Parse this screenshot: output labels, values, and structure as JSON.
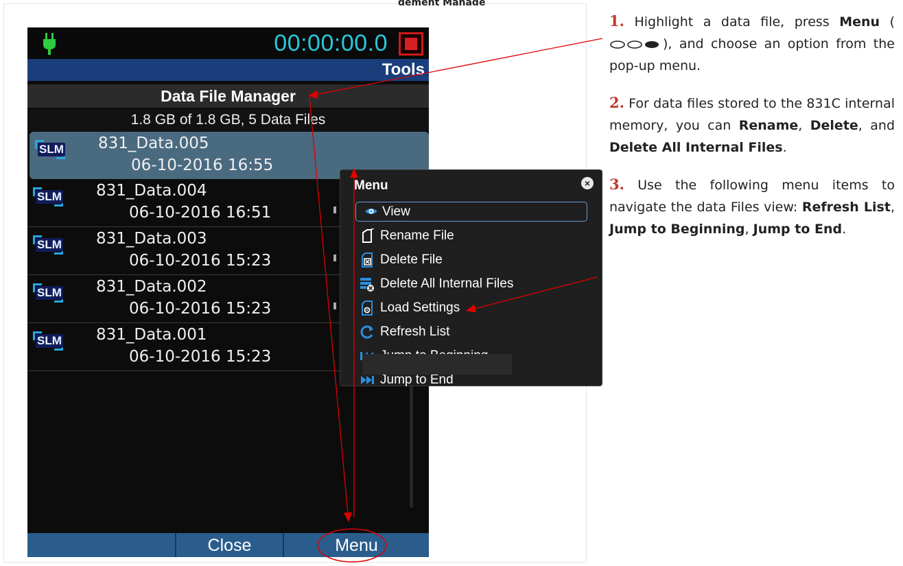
{
  "top_cut_text": "gement Manage",
  "device": {
    "clock": "00:00:00.0",
    "header_title": "Tools",
    "screen_title": "Data File Manager",
    "storage_summary": "1.8 GB of 1.8 GB, 5 Data Files",
    "files": [
      {
        "badge": "SLM",
        "name": "831_Data.005",
        "date": "06-10-2016 16:55",
        "selected": true
      },
      {
        "badge": "SLM",
        "name": "831_Data.004",
        "date": "06-10-2016 16:51",
        "selected": false
      },
      {
        "badge": "SLM",
        "name": "831_Data.003",
        "date": "06-10-2016 15:23",
        "selected": false
      },
      {
        "badge": "SLM",
        "name": "831_Data.002",
        "date": "06-10-2016 15:23",
        "selected": false
      },
      {
        "badge": "SLM",
        "name": "831_Data.001",
        "date": "06-10-2016 15:23",
        "selected": false
      }
    ],
    "bottom_buttons": [
      "",
      "Close",
      "Menu"
    ]
  },
  "popup": {
    "title": "Menu",
    "items": [
      {
        "label": "View",
        "icon": "eye-icon"
      },
      {
        "label": "Rename File",
        "icon": "rename-file-icon"
      },
      {
        "label": "Delete File",
        "icon": "delete-file-icon"
      },
      {
        "label": "Delete All Internal Files",
        "icon": "delete-all-icon"
      },
      {
        "label": "Load Settings",
        "icon": "load-settings-icon"
      },
      {
        "label": "Refresh List",
        "icon": "refresh-icon"
      },
      {
        "label": "Jump to Beginning",
        "icon": "jump-beginning-icon"
      },
      {
        "label": "Jump to End",
        "icon": "jump-end-icon"
      }
    ]
  },
  "notes": {
    "n1": {
      "num": "1.",
      "t1": " Highlight a data file, press ",
      "b1": "Menu",
      "t2": " (",
      "t3": "), and choose an option from the pop-up menu."
    },
    "n2": {
      "num": "2.",
      "t1": " For data files stored to the 831C internal memory, you can ",
      "b1": "Rename",
      "t2": ", ",
      "b2": "Delete",
      "t3": ", and ",
      "b3": "Delete All Internal Files",
      "t4": "."
    },
    "n3": {
      "num": "3.",
      "t1": " Use the following menu items to navigate the data Files view: ",
      "b1": "Refresh List",
      "t2": ", ",
      "b2": "Jump to Beginning",
      "t3": ", ",
      "b3": "Jump to End",
      "t4": "."
    }
  },
  "colors": {
    "annotation": "#e00000",
    "clock": "#28c8dc",
    "header_blue": "#1a3e7c",
    "selected_row": "#4a6a80"
  }
}
